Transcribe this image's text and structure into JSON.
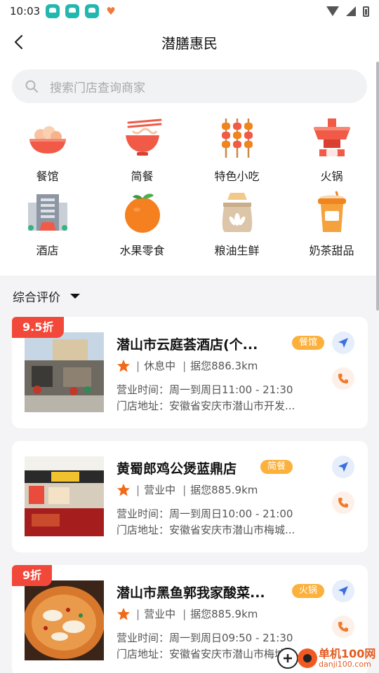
{
  "status_bar": {
    "time": "10:03",
    "app_icons": [
      "app-icon",
      "app-icon",
      "app-icon"
    ]
  },
  "header": {
    "title": "潜膳惠民"
  },
  "search": {
    "placeholder": "搜索门店查询商家"
  },
  "categories": [
    {
      "label": "餐馆",
      "icon": "restaurant-bowl-icon"
    },
    {
      "label": "简餐",
      "icon": "noodle-bowl-icon"
    },
    {
      "label": "特色小吃",
      "icon": "skewers-icon"
    },
    {
      "label": "火锅",
      "icon": "hotpot-icon"
    },
    {
      "label": "酒店",
      "icon": "hotel-building-icon"
    },
    {
      "label": "水果零食",
      "icon": "orange-fruit-icon"
    },
    {
      "label": "粮油生鲜",
      "icon": "grain-sack-icon"
    },
    {
      "label": "奶茶甜品",
      "icon": "milk-tea-cup-icon"
    }
  ],
  "sort": {
    "label": "综合评价"
  },
  "stores": [
    {
      "discount": "9.5折",
      "name": "潜山市云庭荟酒店(个...",
      "tag": "餐馆",
      "separator": "|",
      "status": "休息中",
      "distance": "据您886.3km",
      "hours": "营业时间：周一到周日11:00 - 21:30",
      "address": "门店地址：安徽省安庆市潜山市开发..."
    },
    {
      "discount": "",
      "name": "黄蜀郎鸡公煲蓝鼎店",
      "tag": "简餐",
      "separator": "|",
      "status": "营业中",
      "distance": "据您885.9km",
      "hours": "营业时间：周一到周日10:00 - 21:00",
      "address": "门店地址：安徽省安庆市潜山市梅城..."
    },
    {
      "discount": "9折",
      "name": "潜山市黑鱼郭我家酸菜...",
      "tag": "火锅",
      "separator": "|",
      "status": "营业中",
      "distance": "据您885.9km",
      "hours": "营业时间：周一到周日09:50 - 21:30",
      "address": "门店地址：安徽省安庆市潜山市梅城..."
    }
  ],
  "watermark": {
    "main": "单机100网",
    "sub": "danji100.com"
  },
  "colors": {
    "accent_red": "#f2483a",
    "tag_orange": "#fbb13c",
    "star_orange": "#f06a1a",
    "nav_blue": "#3a6fe0",
    "call_orange": "#f07a2a"
  }
}
